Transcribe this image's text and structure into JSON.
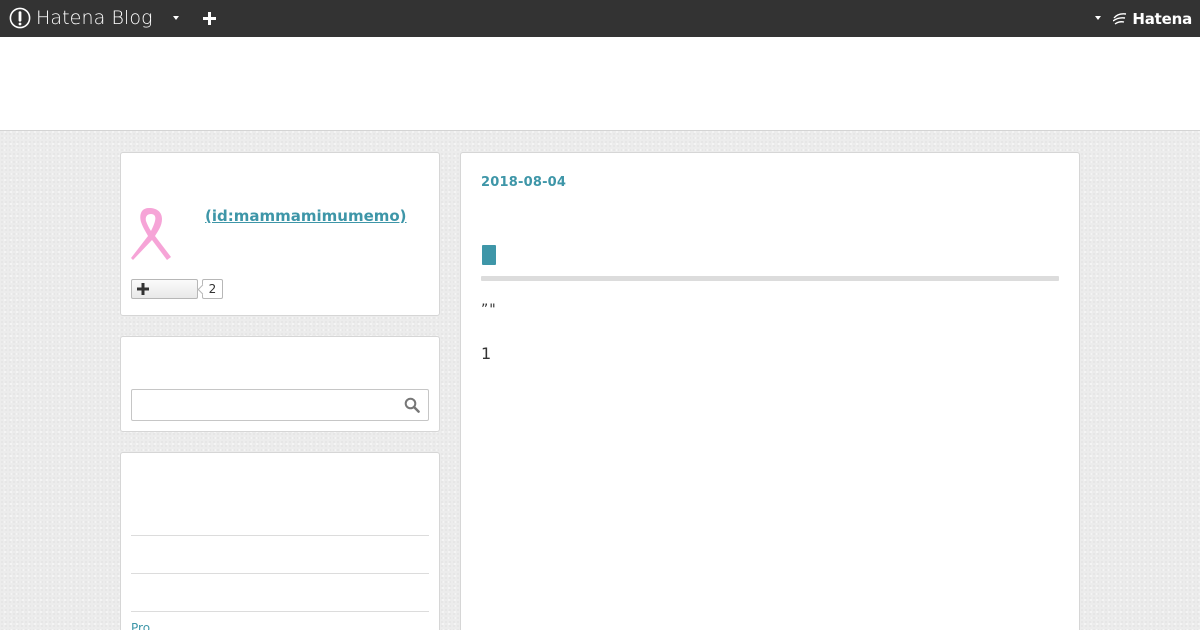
{
  "global_header": {
    "logo_text": "Hatena Blog",
    "logo_icon": "hatena-blog-logo-icon",
    "menu_icon": "chevron-down-icon",
    "new_post_icon": "plus-icon",
    "brand_text": "Hatena",
    "brand_icon": "hatena-brand-icon"
  },
  "profile": {
    "name": " (id:mammamimumemo)",
    "icon": "pink-ribbon-icon",
    "follow_icon": "plus-icon",
    "follow_count": "2"
  },
  "search": {
    "placeholder": "",
    "value": "",
    "icon": "search-icon"
  },
  "links": {
    "pro_label": "Pro"
  },
  "entry": {
    "date": "2018-08-04",
    "title": "",
    "text_line1": "”\"",
    "text_line2": "1"
  },
  "colors": {
    "header_bg": "#333333",
    "accent": "#3e96a8",
    "ribbon": "#f6a4d7",
    "page_bg": "#ececec"
  }
}
